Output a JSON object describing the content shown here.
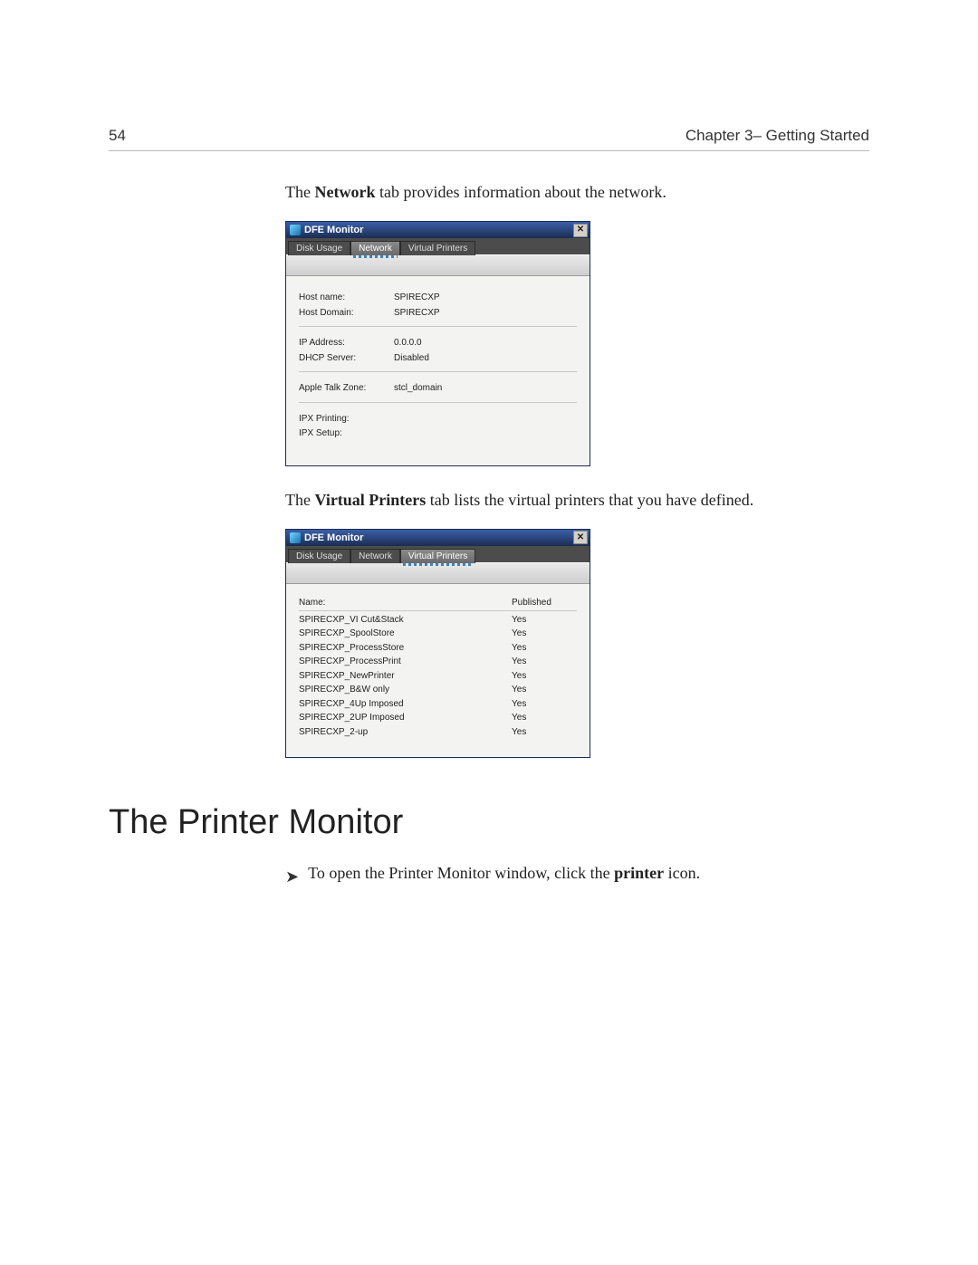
{
  "page": {
    "number": "54",
    "chapter": "Chapter 3– Getting Started"
  },
  "text": {
    "network_intro_pre": "The ",
    "network_intro_bold": "Network",
    "network_intro_post": " tab provides information about the network.",
    "vp_intro_pre": "The ",
    "vp_intro_bold": "Virtual Printers",
    "vp_intro_post": " tab lists the virtual printers that you have defined.",
    "section_heading": "The Printer Monitor",
    "instruction_pre": "To open the Printer Monitor window, click the ",
    "instruction_bold": "printer",
    "instruction_post": " icon.",
    "arrow": "➤"
  },
  "win_common": {
    "title": "DFE Monitor",
    "close": "✕",
    "tabs": {
      "disk": "Disk Usage",
      "net": "Network",
      "vp": "Virtual Printers"
    }
  },
  "network_tab": {
    "rows": {
      "host_name_k": "Host name:",
      "host_name_v": "SPIRECXP",
      "host_domain_k": "Host Domain:",
      "host_domain_v": "SPIRECXP",
      "ip_k": "IP Address:",
      "ip_v": "0.0.0.0",
      "dhcp_k": "DHCP Server:",
      "dhcp_v": "Disabled",
      "atz_k": "Apple Talk Zone:",
      "atz_v": "stcl_domain",
      "ipxprint_k": "IPX Printing:",
      "ipxprint_v": "",
      "ipxsetup_k": "IPX Setup:",
      "ipxsetup_v": ""
    }
  },
  "vp_tab": {
    "header": {
      "name": "Name:",
      "pub": "Published"
    },
    "rows": [
      {
        "name": "SPIRECXP_VI Cut&Stack",
        "pub": "Yes"
      },
      {
        "name": "SPIRECXP_SpoolStore",
        "pub": "Yes"
      },
      {
        "name": "SPIRECXP_ProcessStore",
        "pub": "Yes"
      },
      {
        "name": "SPIRECXP_ProcessPrint",
        "pub": "Yes"
      },
      {
        "name": "SPIRECXP_NewPrinter",
        "pub": "Yes"
      },
      {
        "name": "SPIRECXP_B&W only",
        "pub": "Yes"
      },
      {
        "name": "SPIRECXP_4Up Imposed",
        "pub": "Yes"
      },
      {
        "name": "SPIRECXP_2UP Imposed",
        "pub": "Yes"
      },
      {
        "name": "SPIRECXP_2-up",
        "pub": "Yes"
      }
    ]
  }
}
